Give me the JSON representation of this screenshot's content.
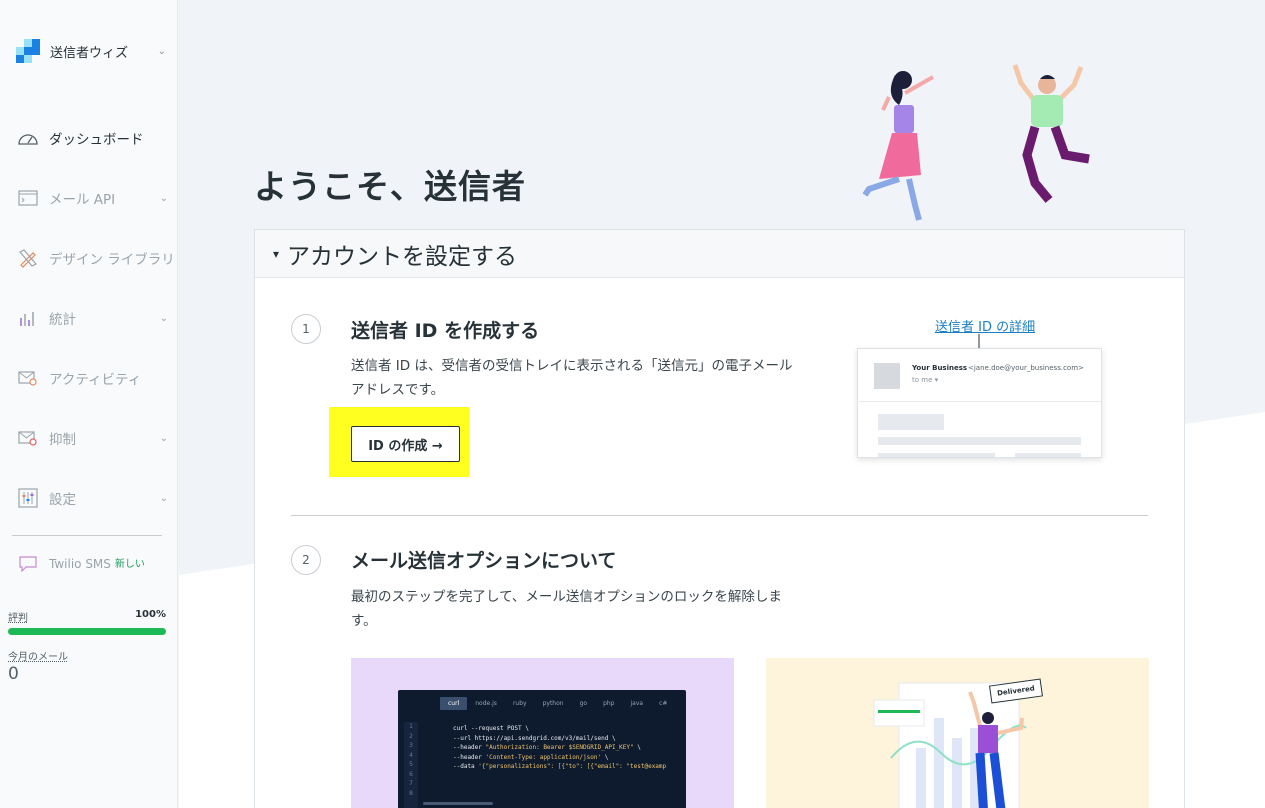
{
  "sidebar": {
    "account_name": "送信者ウィズ",
    "items": [
      {
        "label": "ダッシュボード",
        "icon": "speedometer-icon"
      },
      {
        "label": "メール API",
        "icon": "terminal-icon"
      },
      {
        "label": "デザイン ライブラリ",
        "icon": "pencil-ruler-icon"
      },
      {
        "label": "統計",
        "icon": "bar-chart-icon"
      },
      {
        "label": "アクティビティ",
        "icon": "mail-search-icon"
      },
      {
        "label": "抑制",
        "icon": "mail-block-icon"
      },
      {
        "label": "設定",
        "icon": "sliders-icon"
      }
    ],
    "twilio": {
      "label": "Twilio SMS",
      "badge": "新しい"
    },
    "reputation": {
      "label": "評判",
      "value": "100%",
      "fraction": 1.0
    },
    "monthly_mail": {
      "label": "今月のメール",
      "value": "0"
    }
  },
  "main": {
    "title": "ようこそ、送信者",
    "card_title": "アカウントを設定する",
    "step1": {
      "num": "1",
      "title": "送信者 ID を作成する",
      "desc1": "送信者 ID は、受信者の受信トレイに表示される「送信元」の電子メール",
      "desc2": "アドレスです。",
      "button": "ID の作成 →",
      "link": "送信者 ID の詳細"
    },
    "preview": {
      "business": "Your Business",
      "email": "<jane.doe@your_business.com>",
      "to": "to me ▾"
    },
    "step2": {
      "num": "2",
      "title": "メール送信オプションについて",
      "desc1": "最初のステップを完了して、メール送信オプションのロックを解除しま",
      "desc2": "す。"
    },
    "code_tabs": [
      "curl",
      "node.js",
      "ruby",
      "python",
      "go",
      "php",
      "java",
      "c#"
    ],
    "code_lines": [
      "1",
      "2",
      "3",
      "4",
      "5",
      "6",
      "7",
      "8"
    ],
    "delivered": "Delivered"
  },
  "colors": {
    "accent": "#1a82e2",
    "reputation_bar": "#1db954",
    "highlight": "#ffff20"
  }
}
